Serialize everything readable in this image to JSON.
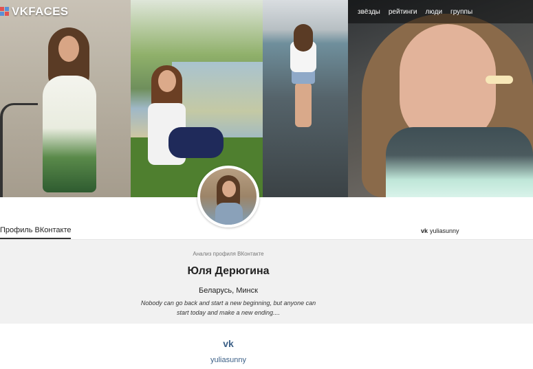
{
  "app": {
    "logo_text": "VKFACES"
  },
  "nav": {
    "items": [
      "звёзды",
      "рейтинги",
      "люди",
      "группы"
    ]
  },
  "tabs": {
    "active_label": "Профиль ВКонтакте",
    "vk_username": "yuliasunny",
    "vk_icon_text": "vk"
  },
  "profile": {
    "subtitle": "Анализ профиля ВКонтакте",
    "name": "Юля Дерюгина",
    "location": "Беларусь, Минск",
    "status": "Nobody can go back and start a new beginning, but anyone can start today and make a new ending...."
  },
  "footer": {
    "vk_icon_text": "vk",
    "username": "yuliasunny"
  },
  "colors": {
    "vk_blue": "#3b5f86",
    "band_bg": "#f1f1f1"
  }
}
